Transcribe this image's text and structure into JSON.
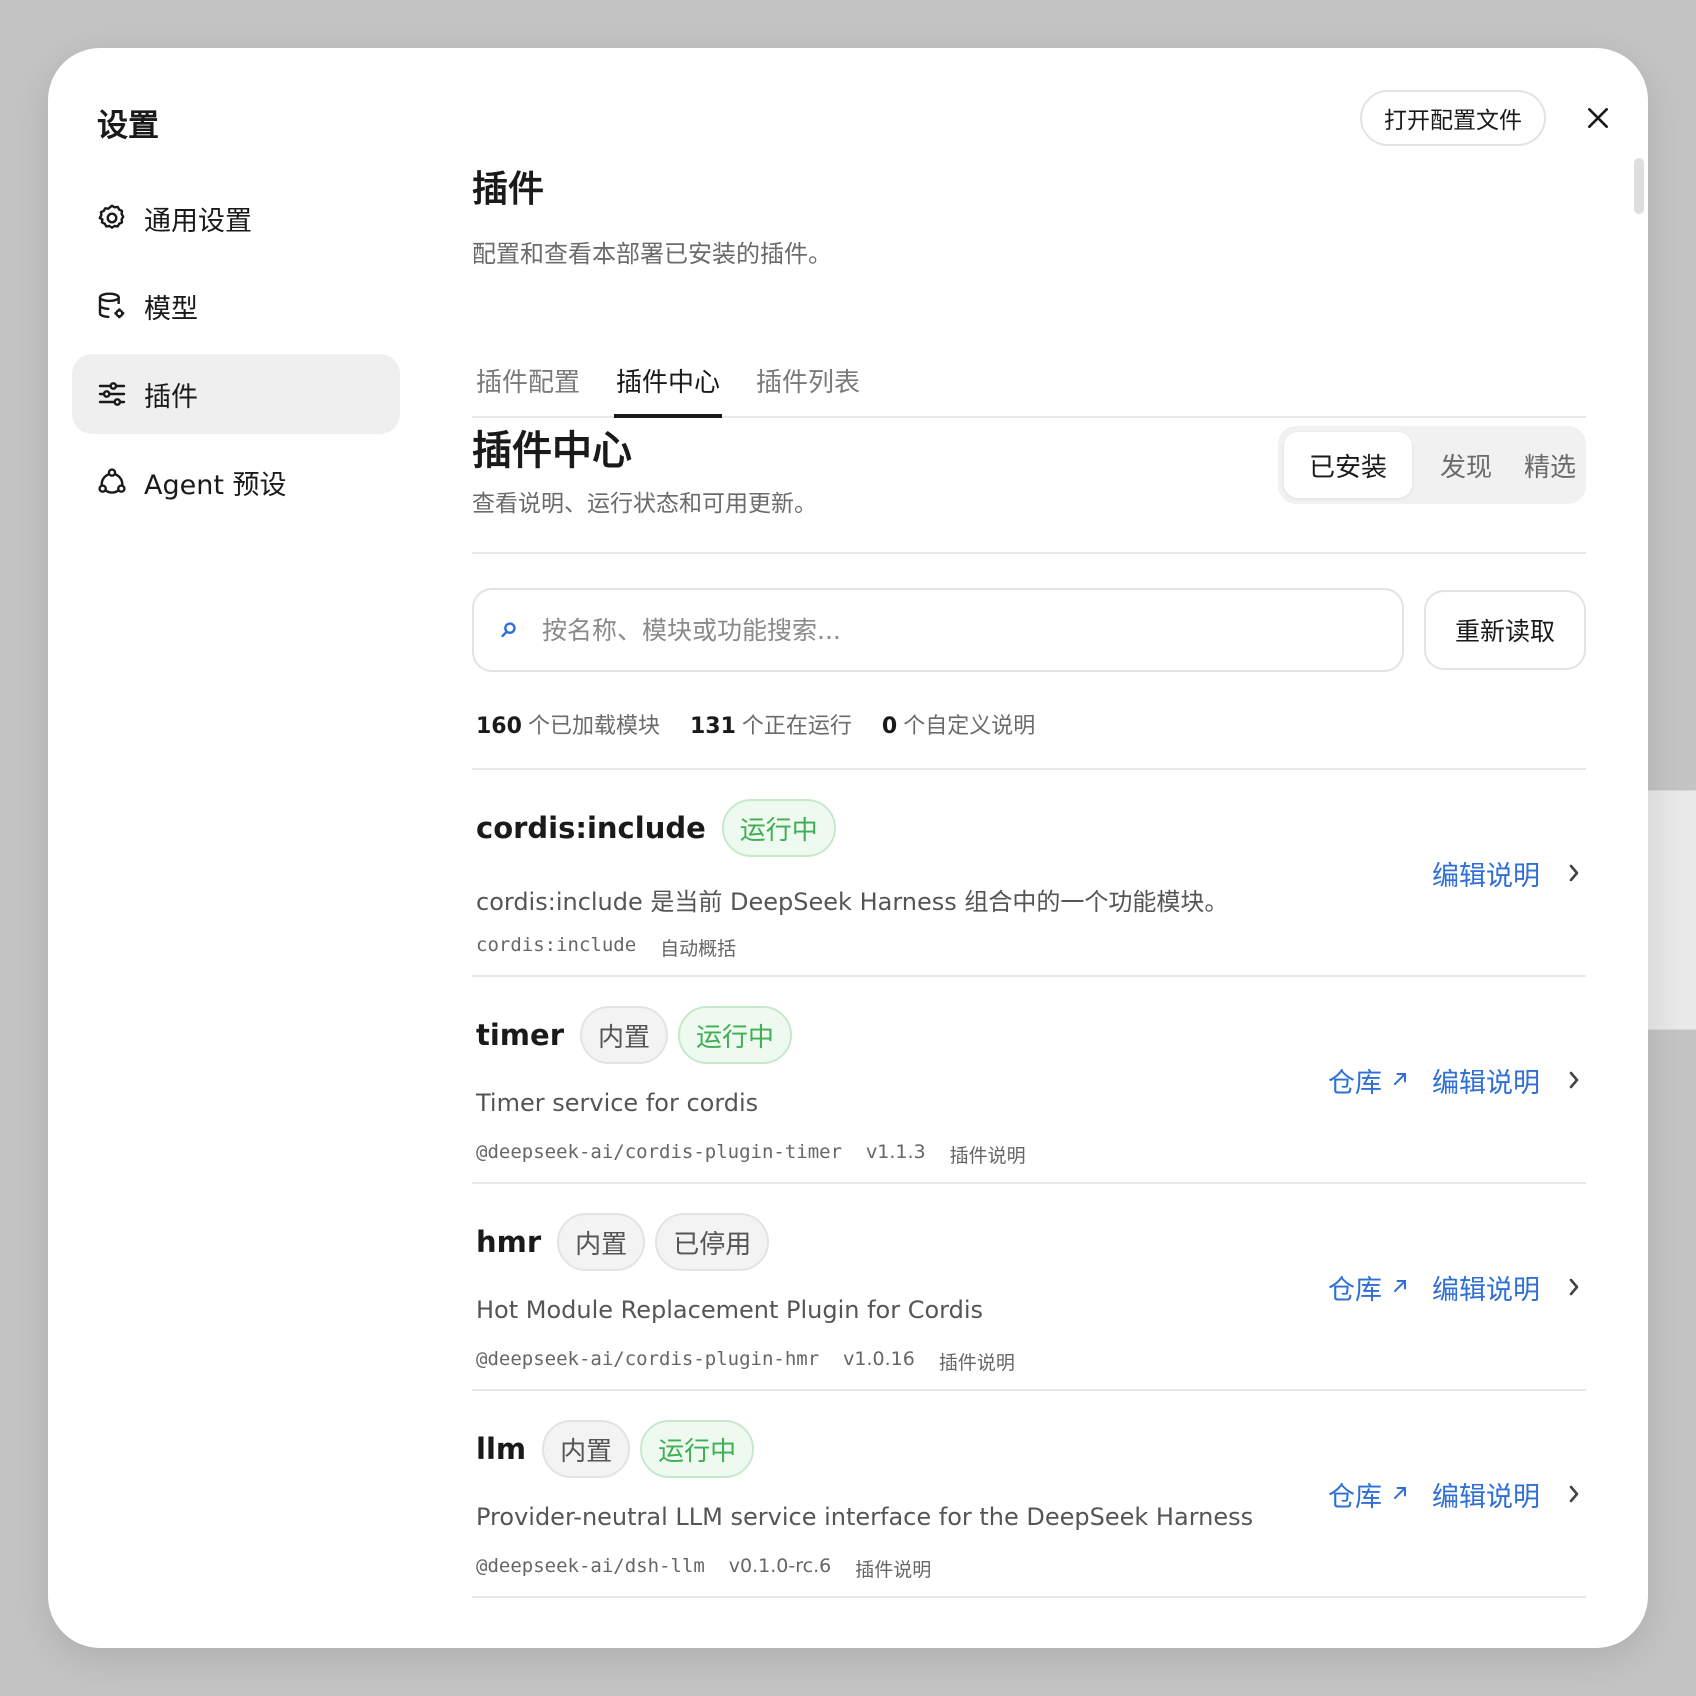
{
  "sidebar": {
    "title": "设置",
    "items": [
      {
        "label": "通用设置",
        "icon": "gear-icon"
      },
      {
        "label": "模型",
        "icon": "database-gear-icon"
      },
      {
        "label": "插件",
        "icon": "sliders-icon"
      },
      {
        "label": "Agent 预设",
        "icon": "agent-icon"
      }
    ],
    "active_index": 2
  },
  "header": {
    "open_config_label": "打开配置文件",
    "close_icon": "close-icon"
  },
  "page": {
    "title": "插件",
    "description": "配置和查看本部署已安装的插件。"
  },
  "tabs": [
    {
      "label": "插件配置"
    },
    {
      "label": "插件中心"
    },
    {
      "label": "插件列表"
    }
  ],
  "active_tab_index": 1,
  "section": {
    "title": "插件中心",
    "description": "查看说明、运行状态和可用更新。"
  },
  "segmented": {
    "options": [
      "已安装",
      "发现",
      "精选"
    ],
    "active_index": 0
  },
  "search": {
    "placeholder": "按名称、模块或功能搜索...",
    "value": ""
  },
  "reload_label": "重新读取",
  "stats": [
    {
      "value": "160",
      "label": "个已加载模块"
    },
    {
      "value": "131",
      "label": "个正在运行"
    },
    {
      "value": "0",
      "label": "个自定义说明"
    }
  ],
  "plugins": [
    {
      "name": "cordis:include",
      "badges": [
        {
          "label": "运行中",
          "kind": "running"
        }
      ],
      "description": "cordis:include 是当前 DeepSeek Harness 组合中的一个功能模块。",
      "package": "cordis:include",
      "version": "",
      "doc_label": "自动概括",
      "repo_label": "",
      "edit_label": "编辑说明"
    },
    {
      "name": "timer",
      "badges": [
        {
          "label": "内置",
          "kind": "builtin"
        },
        {
          "label": "运行中",
          "kind": "running"
        }
      ],
      "description": "Timer service for cordis",
      "package": "@deepseek-ai/cordis-plugin-timer",
      "version": "v1.1.3",
      "doc_label": "插件说明",
      "repo_label": "仓库",
      "edit_label": "编辑说明"
    },
    {
      "name": "hmr",
      "badges": [
        {
          "label": "内置",
          "kind": "builtin"
        },
        {
          "label": "已停用",
          "kind": "stopped"
        }
      ],
      "description": "Hot Module Replacement Plugin for Cordis",
      "package": "@deepseek-ai/cordis-plugin-hmr",
      "version": "v1.0.16",
      "doc_label": "插件说明",
      "repo_label": "仓库",
      "edit_label": "编辑说明"
    },
    {
      "name": "llm",
      "badges": [
        {
          "label": "内置",
          "kind": "builtin"
        },
        {
          "label": "运行中",
          "kind": "running"
        }
      ],
      "description": "Provider-neutral LLM service interface for the DeepSeek Harness",
      "package": "@deepseek-ai/dsh-llm",
      "version": "v0.1.0-rc.6",
      "doc_label": "插件说明",
      "repo_label": "仓库",
      "edit_label": "编辑说明"
    }
  ],
  "colors": {
    "accent_link": "#2f6fd6",
    "running_green": "#3fae55",
    "active_nav_bg": "#efefef"
  }
}
